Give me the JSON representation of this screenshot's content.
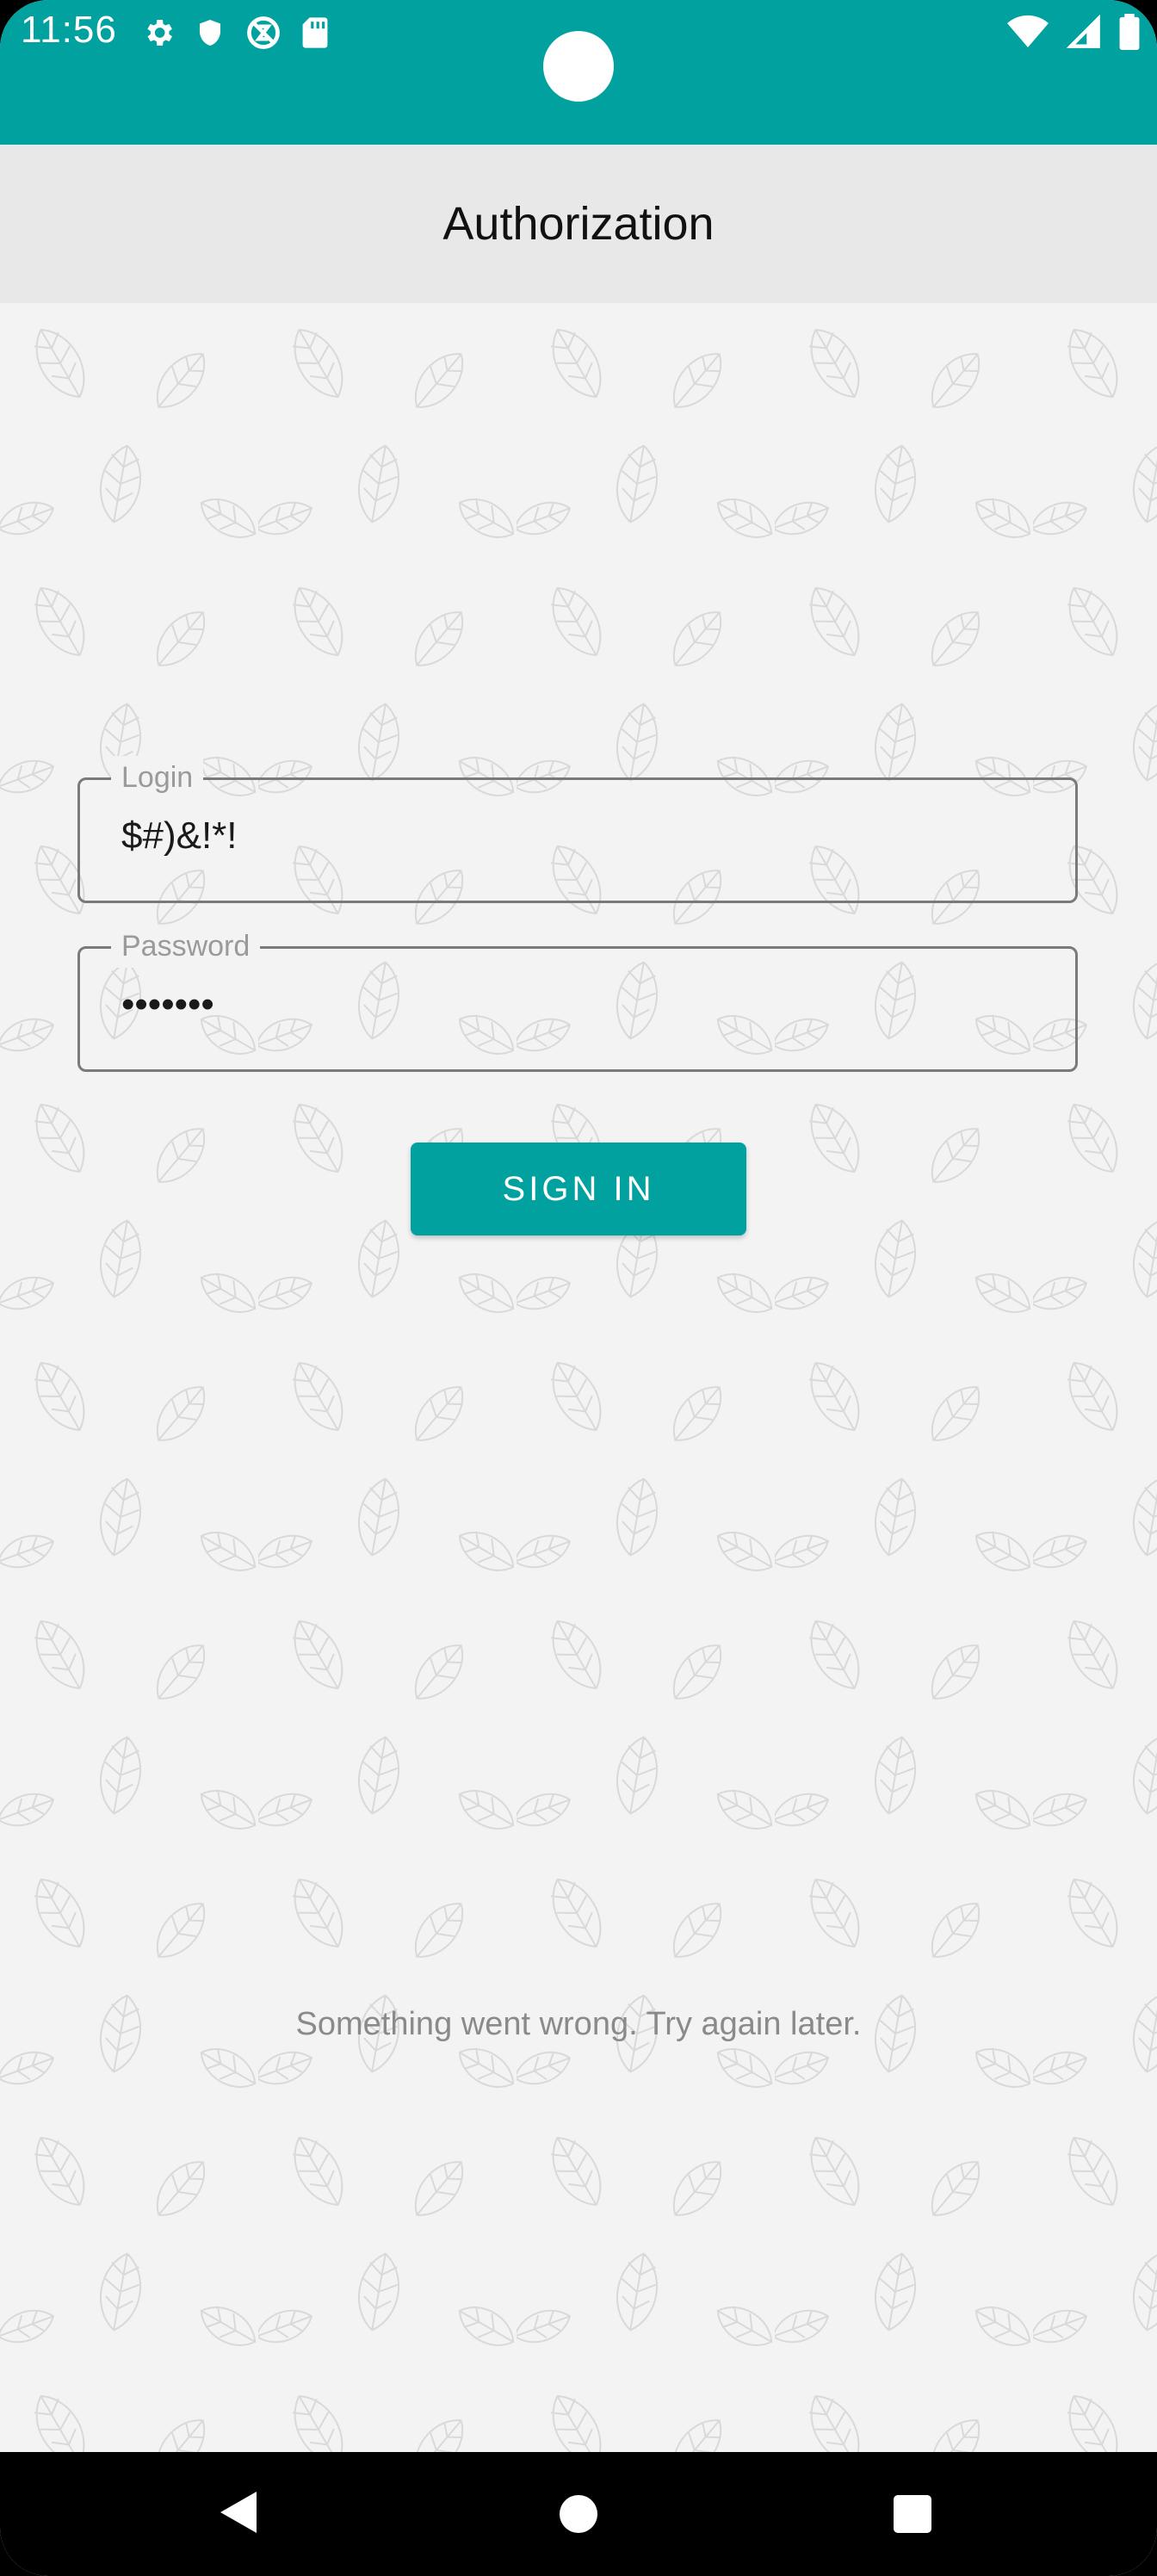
{
  "status_bar": {
    "time": "11:56",
    "left_icons": [
      "settings-icon",
      "shield-icon",
      "no-sync-icon",
      "sd-card-icon"
    ],
    "right_icons": [
      "wifi-icon",
      "signal-icon",
      "battery-icon"
    ]
  },
  "app_bar": {
    "title": "Authorization"
  },
  "form": {
    "login_label": "Login",
    "login_value": "$#)&!*!",
    "password_label": "Password",
    "password_value": "•••••••",
    "submit_label": "SIGN IN"
  },
  "message": {
    "error": "Something went wrong. Try again later."
  },
  "nav_bar": {
    "icons": [
      "back-icon",
      "home-icon",
      "recents-icon"
    ]
  },
  "colors": {
    "primary": "#00a19e",
    "app_bar": "#e8e8e8",
    "background": "#f3f3f3",
    "hint_text": "#9a9a9a"
  }
}
